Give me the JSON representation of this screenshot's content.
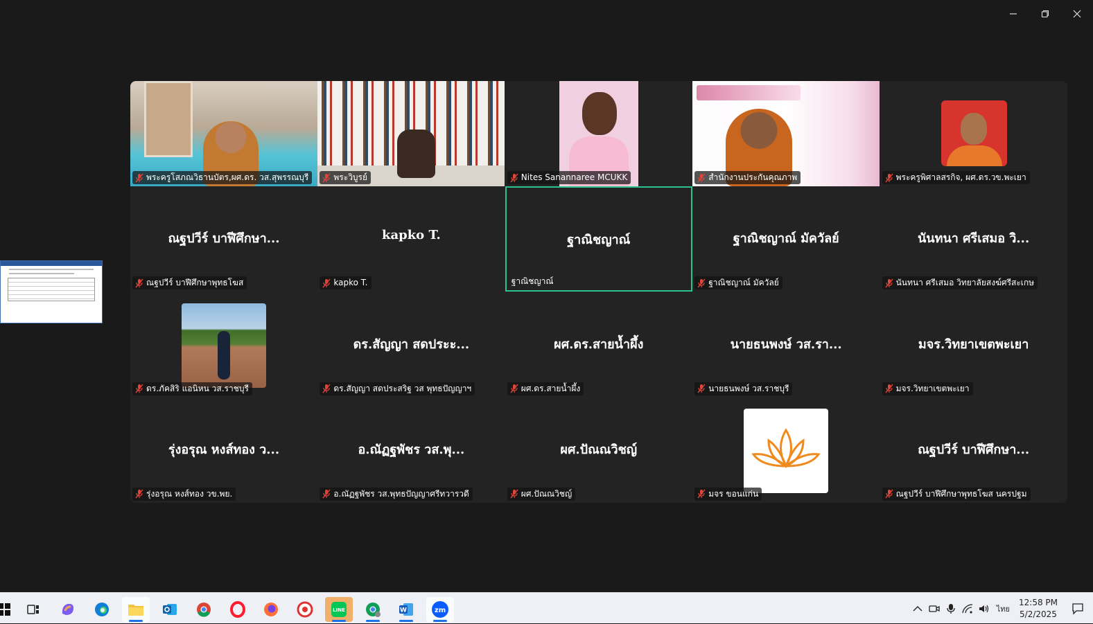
{
  "window": {
    "controls": [
      "minimize-icon",
      "restore-icon",
      "close-icon"
    ]
  },
  "gallery": {
    "tiles": [
      {
        "bigname": "",
        "label": "พระครูโสภณวิธานบัตร,ผศ.ดร. วส.สุพรรณบุรี",
        "muted": true,
        "video": "room"
      },
      {
        "bigname": "",
        "label": "พระวิบูรย์",
        "muted": true,
        "video": "shelf"
      },
      {
        "bigname": "",
        "label": "Nites Sanannaree MCUKK",
        "muted": true,
        "video": "nites"
      },
      {
        "bigname": "",
        "label": "สำนักงานประกันคุณภาพ",
        "muted": true,
        "video": "office"
      },
      {
        "bigname": "",
        "label": "พระครูพิศาลสรกิจ, ผศ.ดร.วข.พะเยา",
        "muted": true,
        "video": "monk"
      },
      {
        "bigname": "ณฐปวีร์ บาฬีศึกษา...",
        "label": "ณฐปวีร์ บาฬีศึกษาพุทธโฆส",
        "muted": true
      },
      {
        "bigname": "kapko T.",
        "label": "kapko T.",
        "muted": true
      },
      {
        "bigname": "ฐาณิชญาณ์",
        "label": "ฐาณิชญาณ์",
        "muted": false,
        "active": true
      },
      {
        "bigname": "ฐาณิชญาณ์ มัควัลย์",
        "label": "ฐาณิชญาณ์ มัควัลย์",
        "muted": true
      },
      {
        "bigname": "นันทนา ศรีเสมอ วิ...",
        "label": "นันทนา ศรีเสมอ วิทยาลัยสงฆ์ศรีสะเกษ",
        "muted": true
      },
      {
        "bigname": "",
        "label": "ดร.ภัคสิริ แอนิหน วส.ราชบุรี",
        "muted": true,
        "video": "outdoor"
      },
      {
        "bigname": "ดร.สัญญา สดประะ...",
        "label": "ดร.สัญญา สดประสริฐ วส พุทธปัญญาฯ",
        "muted": true
      },
      {
        "bigname": "ผศ.ดร.สายน้ำผึ้ง",
        "label": "ผศ.ดร.สายน้ำผึ้ง",
        "muted": true
      },
      {
        "bigname": "นายธนพงษ์ วส.รา...",
        "label": "นายธนพงษ์ วส.ราชบุรี",
        "muted": true
      },
      {
        "bigname": "มจร.วิทยาเขตพะเยา",
        "label": "มจร.วิทยาเขตพะเยา",
        "muted": true
      },
      {
        "bigname": "รุ่งอรุณ หงส์ทอง ว...",
        "label": "รุ่งอรุณ หงส์ทอง วข.พย.",
        "muted": true
      },
      {
        "bigname": "อ.ณัฏฐพัชร วส.พุ...",
        "label": "อ.ณัฏฐพัชร วส.พุทธปัญญาศรีทวารวดี",
        "muted": true
      },
      {
        "bigname": "ผศ.ปัณณวิชญ์",
        "label": "ผศ.ปัณณวิชญ์",
        "muted": true
      },
      {
        "bigname": "",
        "label": "มจร ขอนแก่น",
        "muted": true,
        "video": "lotus"
      },
      {
        "bigname": "ณฐปวีร์ บาฬีศึกษา...",
        "label": "ณฐปวีร์ บาฬีศึกษาพุทธโฆส นครปฐม",
        "muted": true
      }
    ]
  },
  "taskbar": {
    "apps": [
      "start-icon",
      "task-view-icon",
      "copilot-icon",
      "edge-icon",
      "file-explorer-icon",
      "outlook-icon",
      "chrome-icon",
      "opera-icon",
      "firefox-icon",
      "app-icon",
      "line-icon",
      "chrome-profile-icon",
      "word-icon",
      "zoom-icon"
    ],
    "language": "ไทย",
    "time": "12:58 PM",
    "date": "5/2/2025"
  },
  "colors": {
    "active_speaker": "#2ac48e",
    "mic_muted": "#e0443a",
    "taskbar_bg": "#eef0f5"
  }
}
